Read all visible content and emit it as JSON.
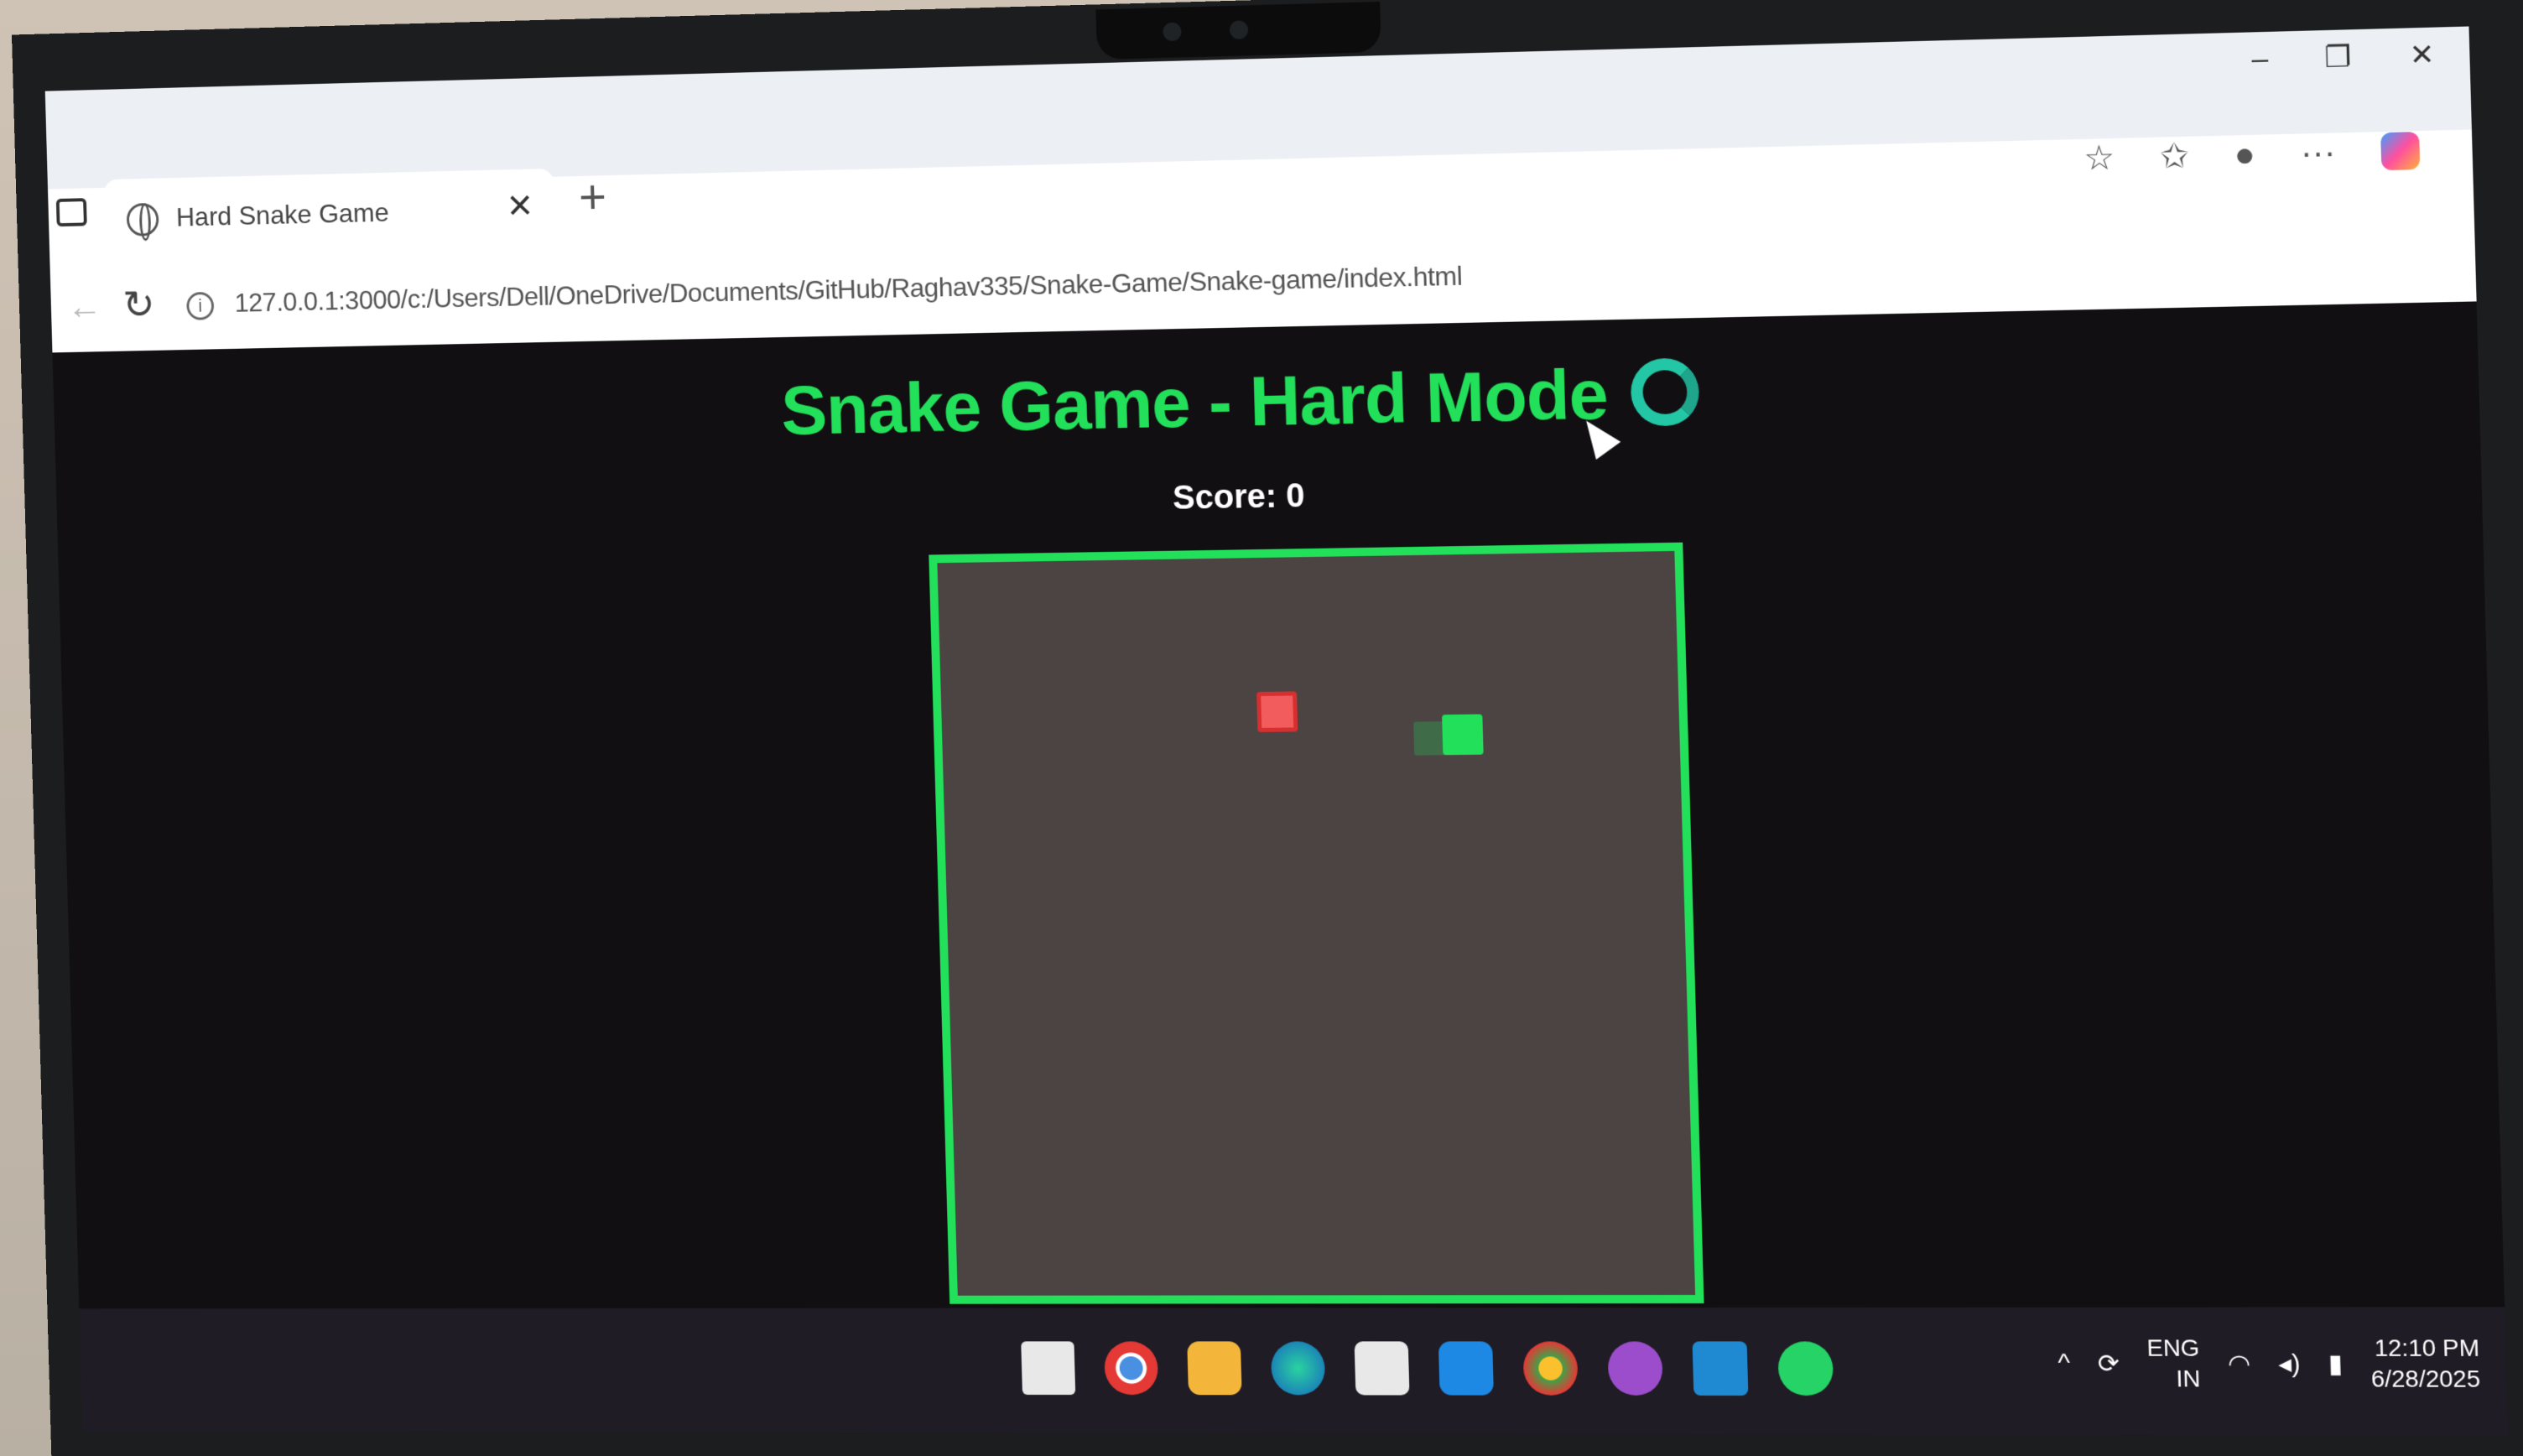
{
  "browser": {
    "tab_title": "Hard Snake Game",
    "tab_close": "✕",
    "new_tab": "+",
    "url": "127.0.0.1:3000/c:/Users/Dell/OneDrive/Documents/GitHub/Raghav335/Snake-Game/Snake-game/index.html",
    "window_controls": {
      "minimize": "–",
      "restore": "❐",
      "close": "✕"
    },
    "toolbar": {
      "favorite": "☆",
      "favorites": "✩",
      "profile": "●",
      "more": "···"
    }
  },
  "game": {
    "title": "Snake Game - Hard Mode",
    "title_icon": "snake-emoji",
    "score_label": "Score: 0",
    "colors": {
      "accent": "#22e05a",
      "board": "#4c4442",
      "food": "#f25c5c",
      "background": "#120f13"
    }
  },
  "taskbar": {
    "apps": [
      "file-explorer-icon",
      "chrome-icon",
      "folder-icon",
      "edge-icon",
      "store-icon",
      "outlook-icon",
      "chrome-profile-icon",
      "github-icon",
      "vscode-icon",
      "whatsapp-icon"
    ],
    "tray": {
      "chevron": "^",
      "language": "ENG",
      "region": "IN",
      "time": "12:10 PM",
      "date": "6/28/2025"
    }
  }
}
